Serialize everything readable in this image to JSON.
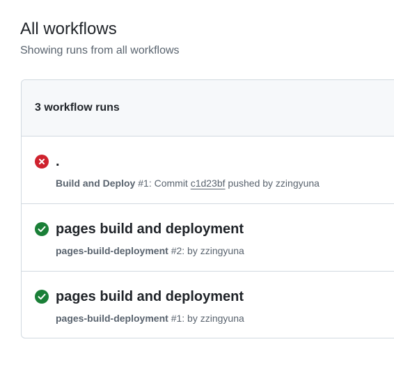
{
  "page": {
    "title": "All workflows",
    "subtitle": "Showing runs from all workflows"
  },
  "runs_box": {
    "header": "3 workflow runs",
    "runs": [
      {
        "status": "failure",
        "status_icon": "x-circle-fill-icon",
        "status_color": "#cf222e",
        "title": ".",
        "workflow": "Build and Deploy",
        "run_number": "#1",
        "meta_prefix": ": Commit ",
        "commit": "c1d23bf",
        "meta_suffix": " pushed by zzingyuna"
      },
      {
        "status": "success",
        "status_icon": "check-circle-fill-icon",
        "status_color": "#1a7f37",
        "title": "pages build and deployment",
        "workflow": "pages-build-deployment",
        "run_number": "#2",
        "meta_prefix": ": by zzingyuna"
      },
      {
        "status": "success",
        "status_icon": "check-circle-fill-icon",
        "status_color": "#1a7f37",
        "title": "pages build and deployment",
        "workflow": "pages-build-deployment",
        "run_number": "#1",
        "meta_prefix": ": by zzingyuna"
      }
    ]
  }
}
